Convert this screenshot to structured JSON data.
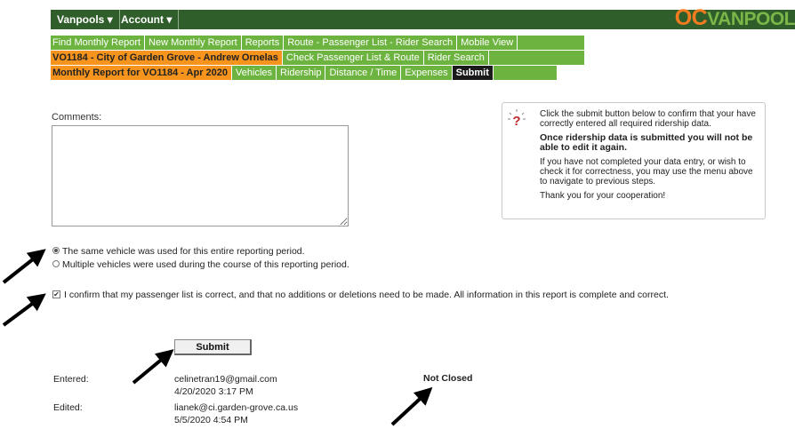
{
  "topbar": {
    "menus": [
      "Vanpools ▾",
      "Account ▾"
    ],
    "logo_oc": "OC",
    "logo_van": "VANPOOL"
  },
  "nav": {
    "row1": [
      "Find Monthly Report",
      "New Monthly Report",
      "Reports",
      "Route - Passenger List - Rider Search",
      "Mobile View"
    ],
    "row2": [
      "VO1184 - City of Garden Grove - Andrew Ornelas",
      "Check Passenger List & Route",
      "Rider Search"
    ],
    "row3": [
      "Monthly Report for VO1184 - Apr 2020",
      "Vehicles",
      "Ridership",
      "Distance / Time",
      "Expenses",
      "Submit"
    ]
  },
  "form": {
    "comments_label": "Comments:",
    "comments_value": "",
    "radio_same": "The same vehicle was used for this entire reporting period.",
    "radio_multiple": "Multiple vehicles were used during the course of this reporting period.",
    "confirm_text": "I confirm that my passenger list is correct, and that no additions or deletions need to be made. All information in this report is complete and correct.",
    "submit_label": "Submit"
  },
  "info": {
    "p1": "Click the submit button below to confirm that your have correctly entered all required ridership data.",
    "p2": "Once ridership data is submitted you will not be able to edit it again.",
    "p3": "If you have not completed your data entry, or wish to check it for correctness, you may use the menu above to navigate to previous steps.",
    "p4": "Thank you for your cooperation!"
  },
  "meta": {
    "entered_label": "Entered:",
    "entered_email": "celinetran19@gmail.com",
    "entered_date": "4/20/2020 3:17 PM",
    "edited_label": "Edited:",
    "edited_email": "lianek@ci.garden-grove.ca.us",
    "edited_date": "5/5/2020 4:54 PM",
    "status": "Not Closed"
  },
  "colors": {
    "topbar": "#2f5e2a",
    "nav_green": "#6db33f",
    "nav_orange": "#f7941d",
    "nav_active": "#1a1a1a",
    "logo_orange": "#f47b20",
    "logo_green": "#7ab648"
  }
}
